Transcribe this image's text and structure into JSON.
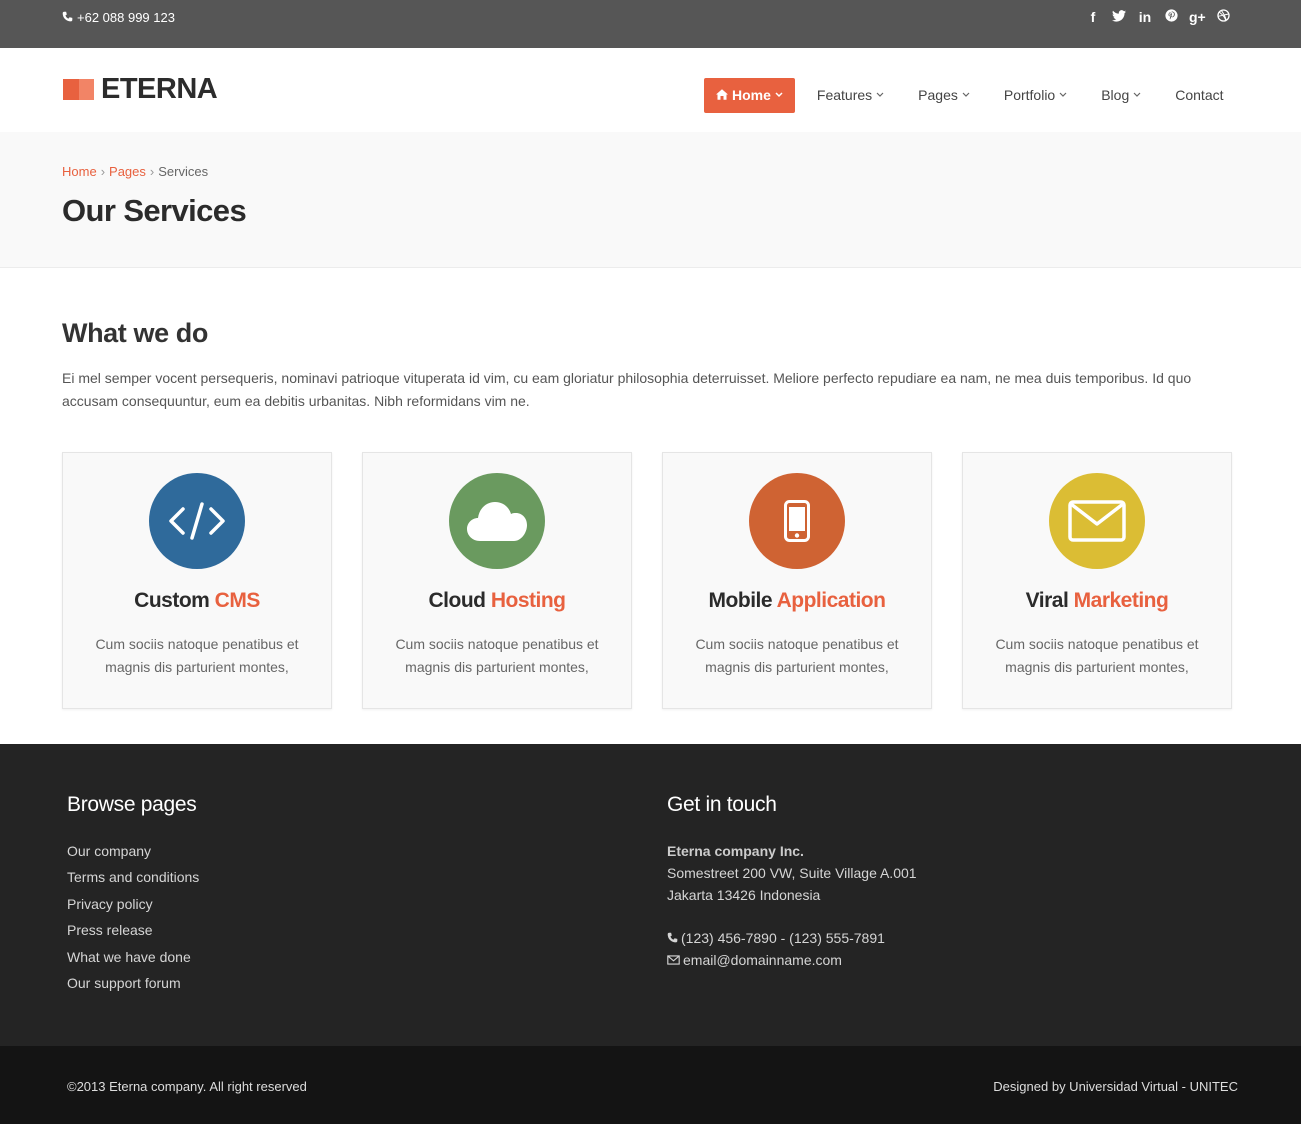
{
  "topbar": {
    "phone": "+62 088 999 123",
    "social": [
      {
        "icon": "facebook-icon",
        "glyph": "f"
      },
      {
        "icon": "twitter-icon",
        "glyph": "t"
      },
      {
        "icon": "linkedin-icon",
        "glyph": "in"
      },
      {
        "icon": "pinterest-icon",
        "glyph": "p"
      },
      {
        "icon": "google-plus-icon",
        "glyph": "g+"
      },
      {
        "icon": "dribbble-icon",
        "glyph": "⊛"
      }
    ]
  },
  "brand": {
    "name": "ETERNA",
    "accent": "#e8613f"
  },
  "nav": {
    "home": "Home",
    "features": "Features",
    "pages": "Pages",
    "portfolio": "Portfolio",
    "blog": "Blog",
    "contact": "Contact"
  },
  "breadcrumb": {
    "home": "Home",
    "pages": "Pages",
    "current": "Services"
  },
  "page_title": "Our Services",
  "section": {
    "title": "What we do",
    "intro": "Ei mel semper vocent persequeris, nominavi patrioque vituperata id vim, cu eam gloriatur philosophia deterruisset. Meliore perfecto repudiare ea nam, ne mea duis temporibus. Id quo accusam consequuntur, eum ea debitis urbanitas. Nibh reformidans vim ne."
  },
  "services": [
    {
      "icon": "code-icon",
      "color": "#2f6a9b",
      "title_a": "Custom",
      "title_b": "CMS",
      "desc": "Cum sociis natoque penatibus et magnis dis parturient montes,"
    },
    {
      "icon": "cloud-icon",
      "color": "#6a9a5f",
      "title_a": "Cloud",
      "title_b": "Hosting",
      "desc": "Cum sociis natoque penatibus et magnis dis parturient montes,"
    },
    {
      "icon": "mobile-icon",
      "color": "#cf6333",
      "title_a": "Mobile",
      "title_b": "Application",
      "desc": "Cum sociis natoque penatibus et magnis dis parturient montes,"
    },
    {
      "icon": "envelope-icon",
      "color": "#dbbd34",
      "title_a": "Viral",
      "title_b": "Marketing",
      "desc": "Cum sociis natoque penatibus et magnis dis parturient montes,"
    }
  ],
  "footer": {
    "browse_title": "Browse pages",
    "links": [
      "Our company",
      "Terms and conditions",
      "Privacy policy",
      "Press release",
      "What we have done",
      "Our support forum"
    ],
    "touch_title": "Get in touch",
    "company": "Eterna company Inc.",
    "address1": "Somestreet 200 VW, Suite Village A.001",
    "address2": "Jakarta 13426 Indonesia",
    "phone": "(123) 456-7890 - (123) 555-7891",
    "email": "email@domainname.com"
  },
  "bottom": {
    "copyright": "©2013 Eterna company. All right reserved",
    "credit": "Designed by Universidad Virtual - UNITEC"
  }
}
